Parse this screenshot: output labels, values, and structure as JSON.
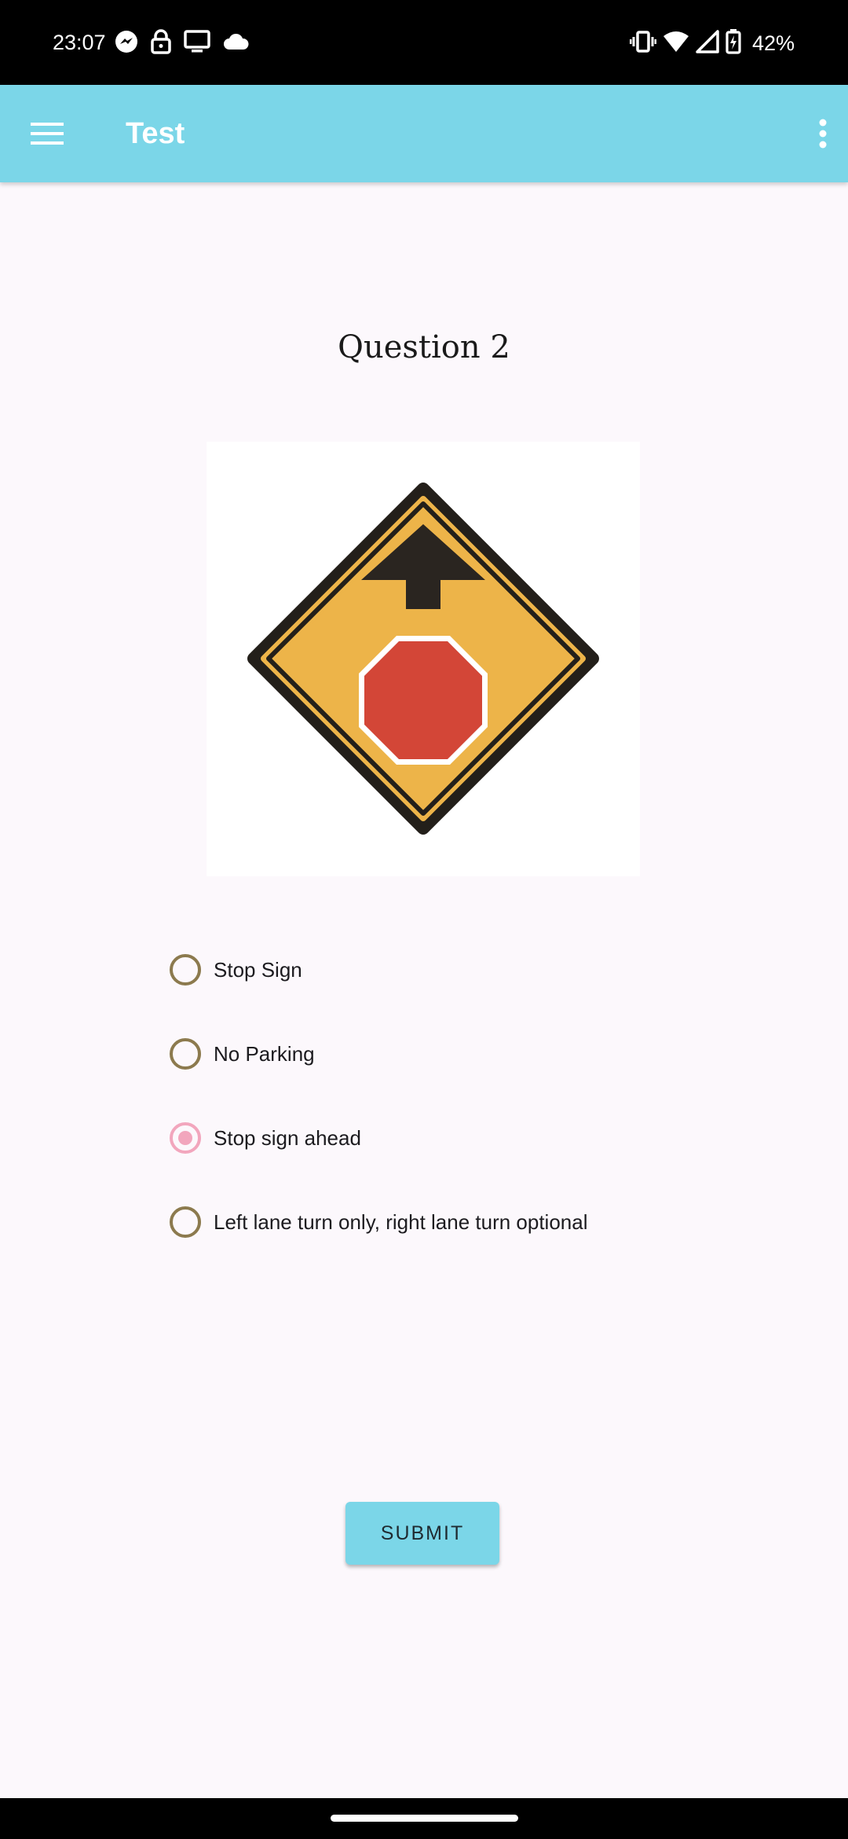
{
  "status_bar": {
    "time": "23:07",
    "battery": "42%",
    "left_icons": [
      "messenger-icon",
      "lock-icon",
      "cast-screen-icon",
      "cloud-icon"
    ],
    "right_icons": [
      "vibrate-icon",
      "wifi-icon",
      "cellular-signal-icon",
      "battery-charging-icon"
    ]
  },
  "app_bar": {
    "title": "Test",
    "color": "#7bd6e8"
  },
  "question": {
    "title": "Question 2",
    "image": "stop-ahead-sign"
  },
  "options": [
    {
      "label": "Stop Sign",
      "selected": false
    },
    {
      "label": "No Parking",
      "selected": false
    },
    {
      "label": "Stop sign ahead",
      "selected": true
    },
    {
      "label": "Left lane turn only, right lane turn optional",
      "selected": false
    }
  ],
  "submit": {
    "label": "SUBMIT"
  },
  "colors": {
    "accent": "#7bd6e8",
    "radio_unselected": "#8c7a4e",
    "radio_selected": "#f2a6bd",
    "sign_yellow": "#edb449",
    "sign_red": "#d34637"
  }
}
